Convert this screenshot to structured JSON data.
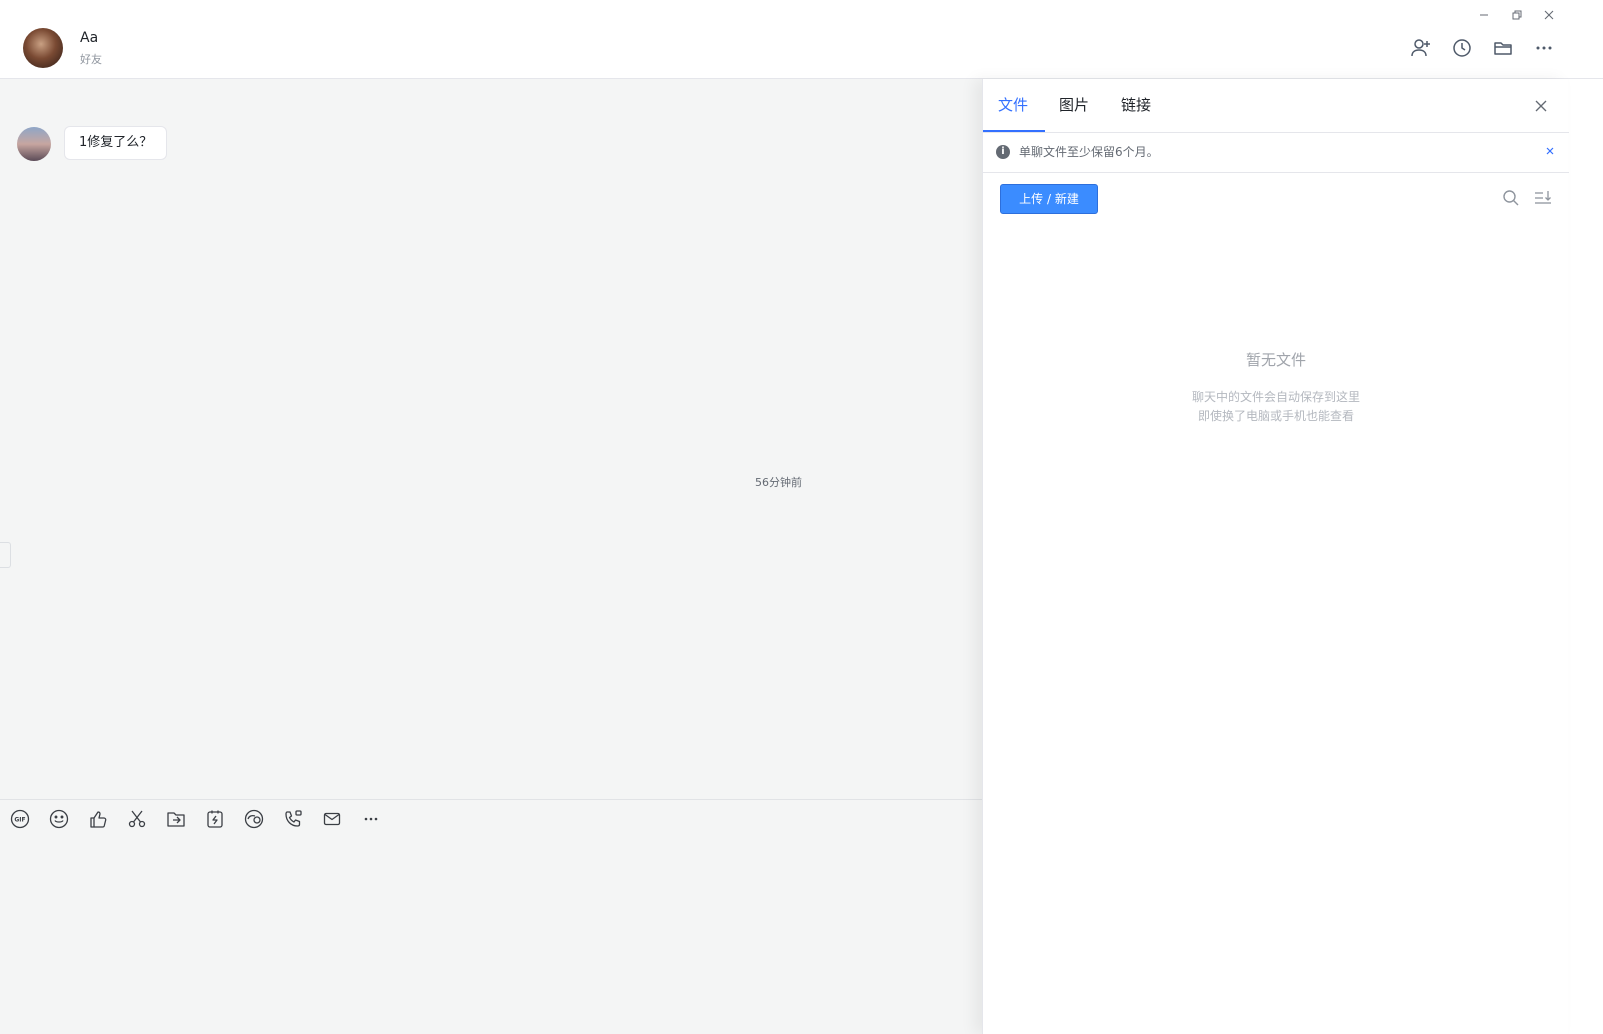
{
  "header": {
    "contact_name": "Aa",
    "contact_tag": "好友",
    "window_controls": [
      "minimize-icon",
      "restore-icon",
      "close-icon"
    ],
    "actions": [
      "add-member-icon",
      "history-icon",
      "folder-icon",
      "more-icon"
    ]
  },
  "chat": {
    "messages": [
      {
        "text": "1修复了么？"
      }
    ],
    "timestamp": "56分钟前"
  },
  "composer": {
    "toolbar": [
      "gif-icon",
      "emoji-icon",
      "thumbs-up-icon",
      "scissors-icon",
      "folder-send-icon",
      "quick-reply-icon",
      "screen-share-icon",
      "phone-call-icon",
      "mail-icon",
      "more-icon"
    ]
  },
  "side_panel": {
    "tabs": [
      {
        "label": "文件",
        "active": true
      },
      {
        "label": "图片",
        "active": false
      },
      {
        "label": "链接",
        "active": false
      }
    ],
    "notice": "单聊文件至少保留6个月。",
    "upload_label": "上传 / 新建",
    "empty_title": "暂无文件",
    "empty_line1": "聊天中的文件会自动保存到这里",
    "empty_line2": "即使换了电脑或手机也能查看"
  },
  "colors": {
    "accent": "#3370ff",
    "button": "#3b8cff",
    "chat_bg": "#f4f5f5"
  }
}
